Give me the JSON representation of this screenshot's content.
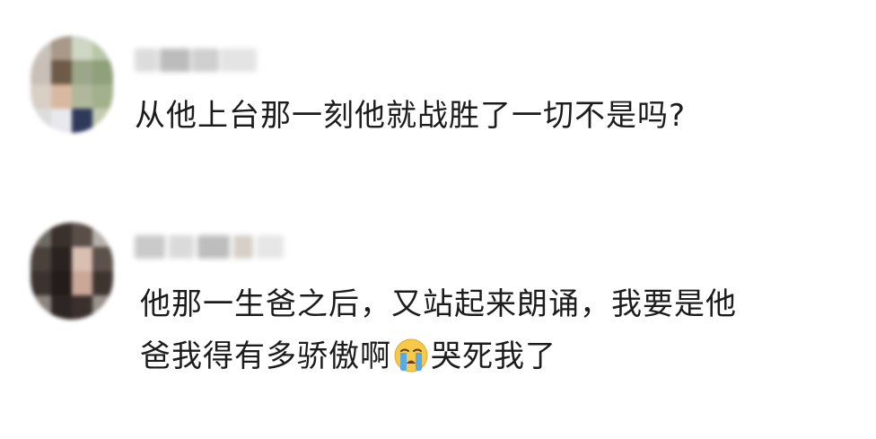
{
  "comments": [
    {
      "avatar": "blurred-user-avatar",
      "username": "",
      "text": "从他上台那一刻他就战胜了一切不是吗?"
    },
    {
      "avatar": "blurred-user-avatar",
      "username": "",
      "text_line1": "他那一生爸之后，又站起来朗诵，我要是他",
      "text_line2_before": "爸我得有多骄傲啊",
      "emoji": "loudly-crying-face-icon",
      "text_line2_after": "哭死我了"
    }
  ],
  "colors": {
    "background": "#ffffff",
    "text": "#1c1c1c",
    "emoji_face": "#f7c948",
    "emoji_tears": "#5aa9e6"
  }
}
